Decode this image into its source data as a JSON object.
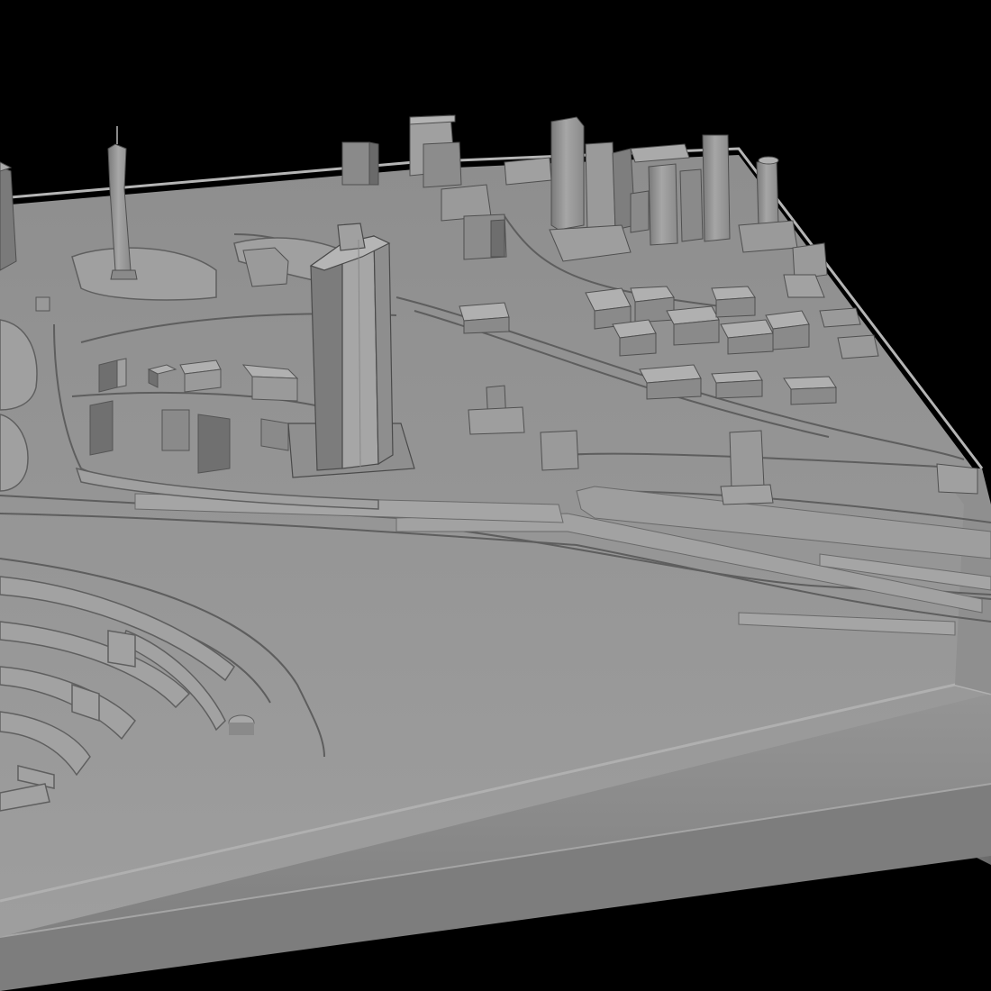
{
  "scene": {
    "background_color": "#000000",
    "model_top_color": "#9a9a9a",
    "model_side_color": "#7e7e7e",
    "model_front_color": "#8a8a8a",
    "building_top_color": "#a8a8a8",
    "building_lit_side_color": "#9c9c9c",
    "building_dark_side_color": "#6f6f6f",
    "road_line_color": "#5a5a5a"
  }
}
